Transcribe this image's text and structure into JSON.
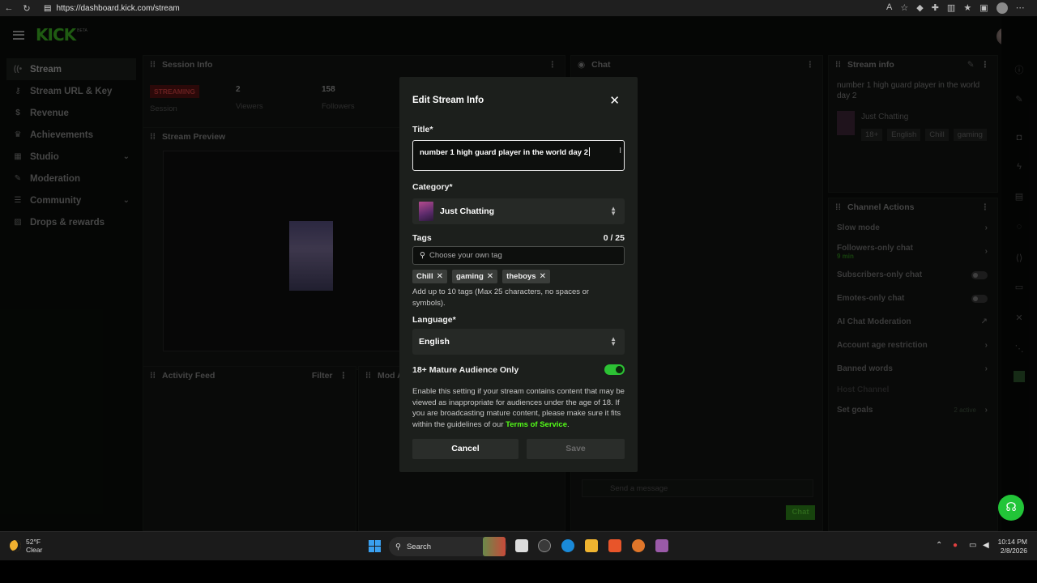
{
  "browser": {
    "url": "https://dashboard.kick.com/stream"
  },
  "app": {
    "logo": "KICK",
    "logo_badge": "BETA"
  },
  "sidebar": {
    "items": [
      {
        "label": "Stream",
        "icon": "signal-icon"
      },
      {
        "label": "Stream URL & Key",
        "icon": "key-icon"
      },
      {
        "label": "Revenue",
        "icon": "dollar-icon"
      },
      {
        "label": "Achievements",
        "icon": "trophy-icon"
      },
      {
        "label": "Studio",
        "icon": "studio-icon"
      },
      {
        "label": "Moderation",
        "icon": "wrench-icon"
      },
      {
        "label": "Community",
        "icon": "community-icon"
      },
      {
        "label": "Drops & rewards",
        "icon": "gift-icon"
      }
    ]
  },
  "session_info": {
    "title": "Session Info",
    "badge": "STREAMING",
    "session_label": "Session",
    "viewers_value": "2",
    "viewers_label": "Viewers",
    "followers_value": "158",
    "followers_label": "Followers"
  },
  "stream_preview": {
    "title": "Stream Preview"
  },
  "activity_feed": {
    "title": "Activity Feed",
    "filter": "Filter"
  },
  "mod_actions": {
    "title": "Mod Ac"
  },
  "chat": {
    "title": "Chat",
    "placeholder": "Send a message",
    "send": "Chat"
  },
  "stream_info_panel": {
    "title": "Stream info",
    "stream_title": "number 1 high guard player in the world day 2",
    "category": "Just Chatting",
    "tags": [
      "18+",
      "English",
      "Chill",
      "gaming"
    ]
  },
  "channel_actions": {
    "title": "Channel Actions",
    "items": [
      {
        "label": "Slow mode"
      },
      {
        "label": "Followers-only chat",
        "sub": "9 min"
      },
      {
        "label": "Subscribers-only chat"
      },
      {
        "label": "Emotes-only chat"
      },
      {
        "label": "AI Chat Moderation"
      },
      {
        "label": "Account age restriction"
      },
      {
        "label": "Banned words"
      },
      {
        "label": "Host Channel"
      },
      {
        "label": "Set goals",
        "meta": "2 active"
      }
    ]
  },
  "modal": {
    "heading": "Edit Stream Info",
    "title_label": "Title*",
    "title_value": "number 1 high guard player in the world day 2",
    "category_label": "Category*",
    "category_value": "Just Chatting",
    "tags_label": "Tags",
    "tags_count": "0 / 25",
    "tags_placeholder": "Choose your own tag",
    "tags": [
      "Chill",
      "gaming",
      "theboys"
    ],
    "tags_help": "Add up to 10 tags (Max 25 characters, no spaces or symbols).",
    "language_label": "Language*",
    "language_value": "English",
    "mature_label": "18+ Mature Audience Only",
    "mature_enabled": true,
    "mature_help": "Enable this setting if your stream contains content that may be viewed as inappropriate for audiences under the age of 18. If you are broadcasting mature content, please make sure it fits within the guidelines of our",
    "tos_link": "Terms of Service",
    "tos_end": ".",
    "cancel": "Cancel",
    "save": "Save",
    "accent_color": "#53fc18"
  },
  "taskbar": {
    "temp": "52°F",
    "weather": "Clear",
    "search": "Search",
    "time": "10:14 PM",
    "date": "2/8/2026"
  }
}
